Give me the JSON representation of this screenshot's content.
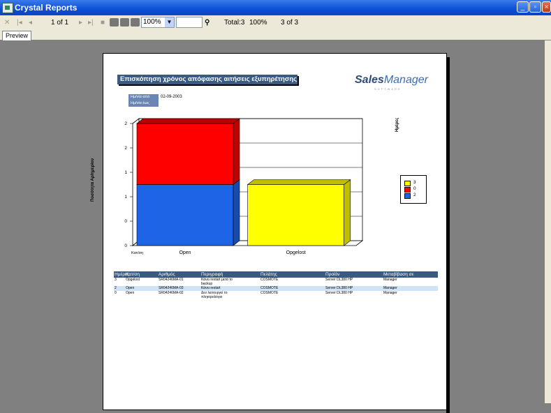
{
  "window": {
    "title": "Crystal Reports"
  },
  "toolbar": {
    "page_indicator": "1 of 1",
    "zoom": "100%",
    "status_total": "Total:3",
    "status_zoom": "100%",
    "status_records": "3 of 3"
  },
  "tabs": [
    "Preview"
  ],
  "report": {
    "title": "Επισκόπηση χρόνος απόφασης αιτήσεις εξυπηρέτησης",
    "logo_a": "Sales",
    "logo_b": "Manager",
    "logo_sub": "SOFTWARE",
    "filter_from_label": "Ημ/νία από",
    "filter_to_label": "Ημ/νία έως",
    "filter_from_value": "02-09-2003",
    "chart_ylabel": "Ποσότητα Αρ/ημερίου",
    "chart_right_label": "Ημέρες",
    "table": {
      "headers": [
        "Ημέρες",
        "Κατ/ση",
        "Αριθμός",
        "Περιγραφή",
        "Πελάτης",
        "Προϊόν",
        "Μεταβίβαση σε"
      ],
      "rows": [
        [
          "3",
          "Opgelost",
          "SR04246MA-01",
          "Κάνει restart μετά το backup",
          "COSMOTE",
          "Server DL380 HP",
          "Manager"
        ],
        [
          "2",
          "Open",
          "SR04246MA-03",
          "Κάνει restart",
          "COSMOTE",
          "Server DL380 HP",
          "Manager"
        ],
        [
          "0",
          "Open",
          "SR04246MA-02",
          "Δεν λειτουργεί το πληκτρολόγιο",
          "COSMOTE",
          "Server DL380 HP",
          "Manager"
        ]
      ]
    }
  },
  "chart_data": {
    "type": "bar",
    "stacked": true,
    "categories": [
      "Open",
      "Opgelost"
    ],
    "category_axis_label": "Κατ/ση",
    "y_ticks": [
      "0",
      "0",
      "1",
      "1",
      "2",
      "2"
    ],
    "ylim": [
      0,
      2.5
    ],
    "series": [
      {
        "name": "2",
        "color": "#1e64e6",
        "values": [
          1.25,
          0
        ]
      },
      {
        "name": "0",
        "color": "#ff0000",
        "values": [
          1.25,
          0
        ]
      },
      {
        "name": "3",
        "color": "#ffff00",
        "values": [
          0,
          1.25
        ]
      }
    ],
    "legend_position": "right",
    "grid": true
  }
}
